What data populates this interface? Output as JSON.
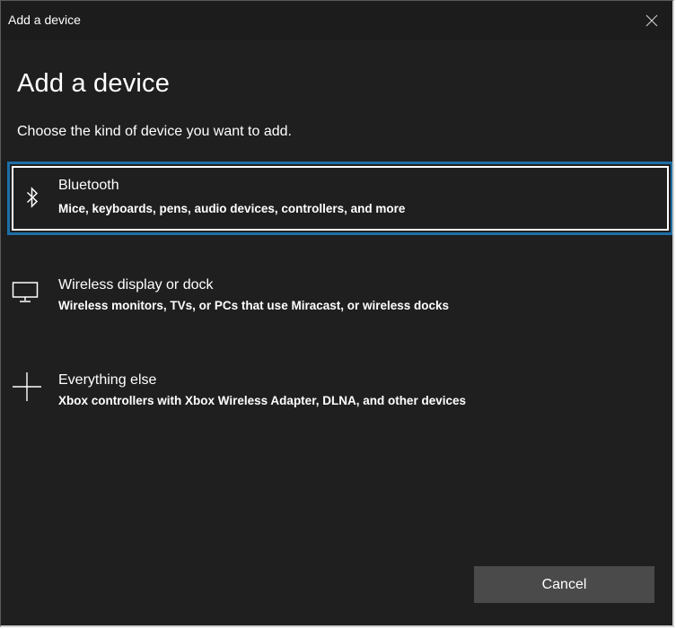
{
  "window": {
    "title": "Add a device"
  },
  "dialog": {
    "heading": "Add a device",
    "subtitle": "Choose the kind of device you want to add."
  },
  "options": [
    {
      "icon": "bluetooth-icon",
      "name": "Bluetooth",
      "description": "Mice, keyboards, pens, audio devices, controllers, and more",
      "selected": true
    },
    {
      "icon": "monitor-icon",
      "name": "Wireless display or dock",
      "description": "Wireless monitors, TVs, or PCs that use Miracast, or wireless docks",
      "selected": false
    },
    {
      "icon": "plus-icon",
      "name": "Everything else",
      "description": "Xbox controllers with Xbox Wireless Adapter, DLNA, and other devices",
      "selected": false
    }
  ],
  "buttons": {
    "cancel_label": "Cancel"
  },
  "colors": {
    "background": "#1f1f1f",
    "titlebar": "#1c1c1c",
    "selection_outline": "#1d6fa6",
    "button": "#4a4a4a",
    "text": "#ffffff"
  }
}
